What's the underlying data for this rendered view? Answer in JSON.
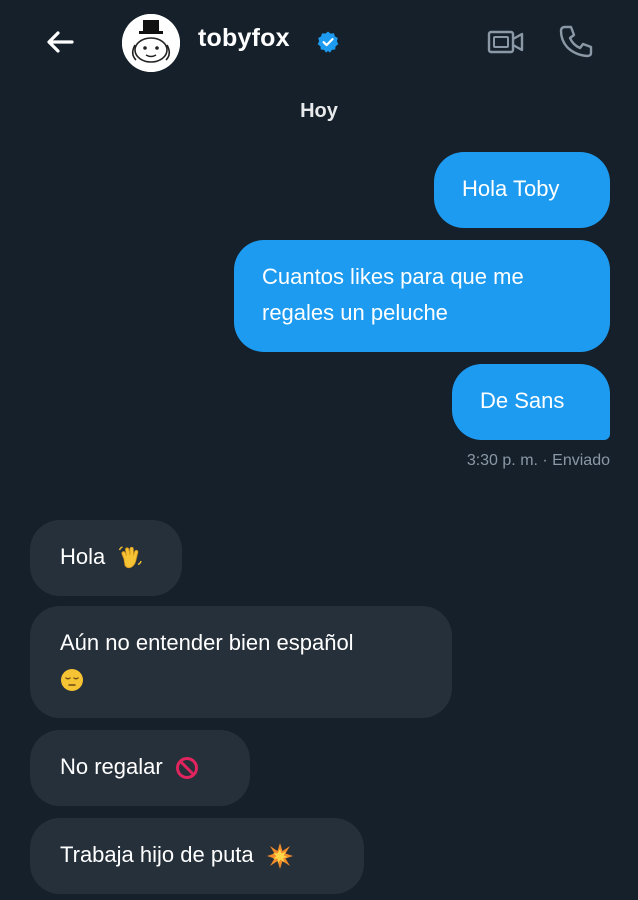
{
  "header": {
    "username": "tobyfox",
    "verified": true,
    "back_icon": "arrow-left-icon",
    "video_icon": "video-call-icon",
    "phone_icon": "phone-call-icon",
    "avatar_icon": "dog-avatar"
  },
  "conversation": {
    "day_label": "Hoy",
    "sent": [
      {
        "text": "Hola Toby"
      },
      {
        "text": "Cuantos likes para que me regales un peluche"
      },
      {
        "text": "De Sans"
      }
    ],
    "sent_status": "3:30 p. m. · Enviado",
    "received": [
      {
        "text": "Hola",
        "emoji": "waving-hand-icon"
      },
      {
        "text": "Aún no entender bien español",
        "emoji": "pensive-face-icon"
      },
      {
        "text": "No regalar",
        "emoji": "prohibited-icon"
      },
      {
        "text": "Trabaja hijo de puta",
        "emoji": "collision-icon"
      }
    ]
  },
  "colors": {
    "background": "#15202b",
    "sent_bubble": "#1d9bf0",
    "received_bubble": "#26303a",
    "timestamp": "#8b98a5"
  }
}
